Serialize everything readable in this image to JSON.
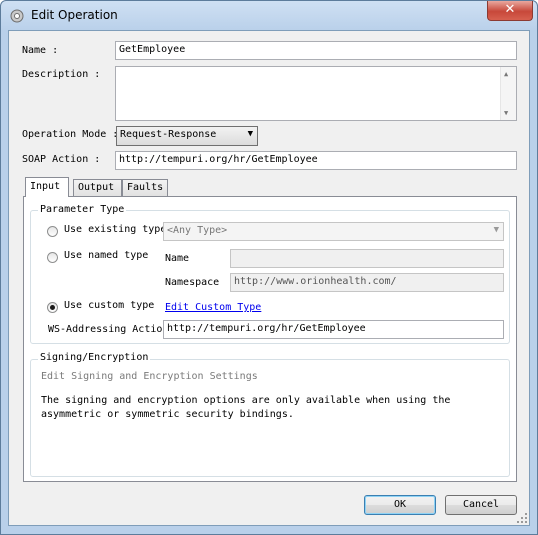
{
  "window": {
    "title": "Edit Operation",
    "close_glyph": "✕"
  },
  "form": {
    "name_label": "Name :",
    "name_value": "GetEmployee",
    "description_label": "Description :",
    "description_value": "",
    "operation_mode_label": "Operation Mode :",
    "operation_mode_value": "Request-Response",
    "soap_action_label": "SOAP Action :",
    "soap_action_value": "http://tempuri.org/hr/GetEmployee"
  },
  "tabs": [
    {
      "label": "Input",
      "active": true
    },
    {
      "label": "Output",
      "active": false
    },
    {
      "label": "Faults",
      "active": false
    }
  ],
  "parameter_type": {
    "title": "Parameter Type",
    "use_existing_label": "Use existing type",
    "existing_value": "<Any Type>",
    "use_named_label": "Use named type",
    "name_label": "Name",
    "name_value": "",
    "namespace_label": "Namespace",
    "namespace_value": "http://www.orionhealth.com/",
    "use_custom_label": "Use custom type",
    "edit_custom_link": "Edit Custom Type",
    "selected": "custom",
    "ws_addressing_label": "WS-Addressing Action",
    "ws_addressing_value": "http://tempuri.org/hr/GetEmployee"
  },
  "signing": {
    "title": "Signing/Encryption",
    "edit_label": "Edit Signing and Encryption Settings",
    "note_line1": "The signing and encryption options are only available when using the",
    "note_line2": "asymmetric or symmetric security bindings."
  },
  "buttons": {
    "ok": "OK",
    "cancel": "Cancel"
  }
}
